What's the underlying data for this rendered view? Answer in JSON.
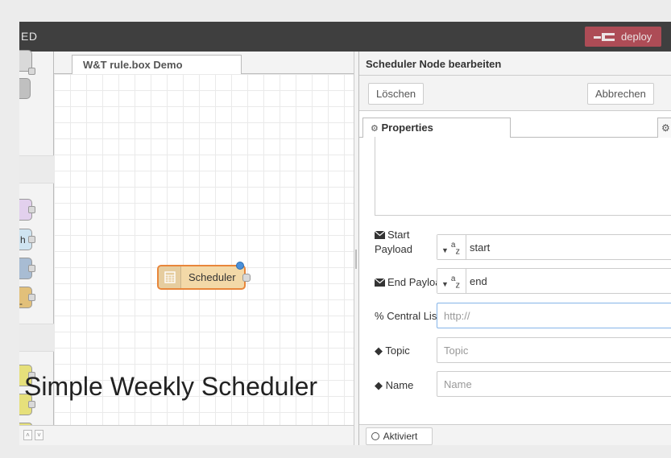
{
  "header": {
    "logo_text": "ED",
    "deploy_label": "deploy"
  },
  "palette": {
    "letter_h": "h",
    "dash": "-"
  },
  "workspace": {
    "flow_tab": "W&T rule.box Demo",
    "node_label": "Scheduler"
  },
  "editor": {
    "title": "Scheduler Node bearbeiten",
    "delete_label": "Löschen",
    "cancel_label": "Abbrechen",
    "tab_properties": "Properties",
    "start_payload_line1": "Start",
    "start_payload_line2": "Payload",
    "start_payload_value": "start",
    "end_payload_label": "End Payload",
    "end_payload_value": "end",
    "type_symbol": "a",
    "type_sub": "z",
    "central_list_label": "Central List",
    "central_list_placeholder": "http://",
    "topic_label": "Topic",
    "topic_placeholder": "Topic",
    "name_label": "Name",
    "name_placeholder": "Name",
    "enabled_label": "Aktiviert"
  },
  "caption": "Simple Weekly Scheduler",
  "colors": {
    "header_bg": "#3f3f3f",
    "deploy_bg": "#ad4c56",
    "node_fill": "#f3d9a8",
    "node_border": "#e8863b",
    "status_dot": "#4a90d9"
  }
}
